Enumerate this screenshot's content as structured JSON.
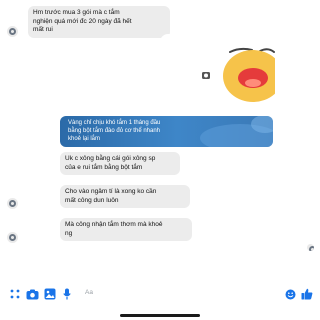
{
  "messages": [
    {
      "text": "Hm trước mua 3 gói mà c tắm\nnghiện quá mới đc 20 ngày đã hết\nmất rui"
    },
    {
      "text": "Uk c xông bằng cái gói xông sp\ncủa e rui tắm bằng bột tắm"
    },
    {
      "text": "Cho vào ngâm tí là xong ko cần\nmất công dun luôn"
    },
    {
      "text": "Mà công nhận tắm thơm mà khoẻ\nng"
    }
  ],
  "shared_post": {
    "text": "Vàng chỉ chịu khó tắm 1 tháng đầu\nbằng bột tắm đào đỏ cơ thể nhanh\nkhoẻ lại lắm"
  },
  "composer": {
    "placeholder": "Aa"
  },
  "icons": {
    "menu": "grid-dots-icon",
    "camera": "camera-icon",
    "gallery": "image-icon",
    "mic": "microphone-icon",
    "emoji": "emoji-icon",
    "like": "thumbs-up-icon"
  },
  "colors": {
    "accent": "#1a74e8",
    "bubble": "#ececec",
    "banner": "#2b6aa8"
  }
}
